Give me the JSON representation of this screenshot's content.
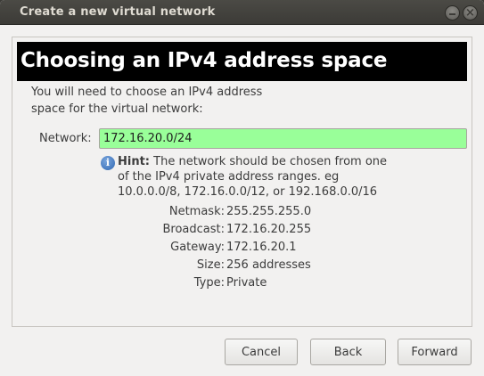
{
  "window": {
    "title": "Create a new virtual network"
  },
  "page": {
    "heading": "Choosing an IPv4 address space",
    "intro_line1": "You will need to choose an IPv4 address",
    "intro_line2": "space for the virtual network:"
  },
  "network": {
    "label": "Network:",
    "value": "172.16.20.0/24"
  },
  "hint": {
    "title": "Hint:",
    "line1": "The network should be chosen from one",
    "line2": "of the IPv4 private address ranges. eg",
    "line3": "10.0.0.0/8,  172.16.0.0/12, or 192.168.0.0/16"
  },
  "details": [
    {
      "label": "Netmask:",
      "value": "255.255.255.0"
    },
    {
      "label": "Broadcast:",
      "value": "172.16.20.255"
    },
    {
      "label": "Gateway:",
      "value": "172.16.20.1"
    },
    {
      "label": "Size:",
      "value": "256 addresses"
    },
    {
      "label": "Type:",
      "value": "Private"
    }
  ],
  "buttons": {
    "cancel": "Cancel",
    "back": "Back",
    "forward": "Forward"
  },
  "colors": {
    "valid_input_bg": "#99ff99",
    "banner_bg": "#000000",
    "titlebar_bg": "#3c3b37"
  },
  "icons": {
    "hint": "info-icon",
    "minimize": "minimize-icon",
    "close": "close-icon"
  }
}
